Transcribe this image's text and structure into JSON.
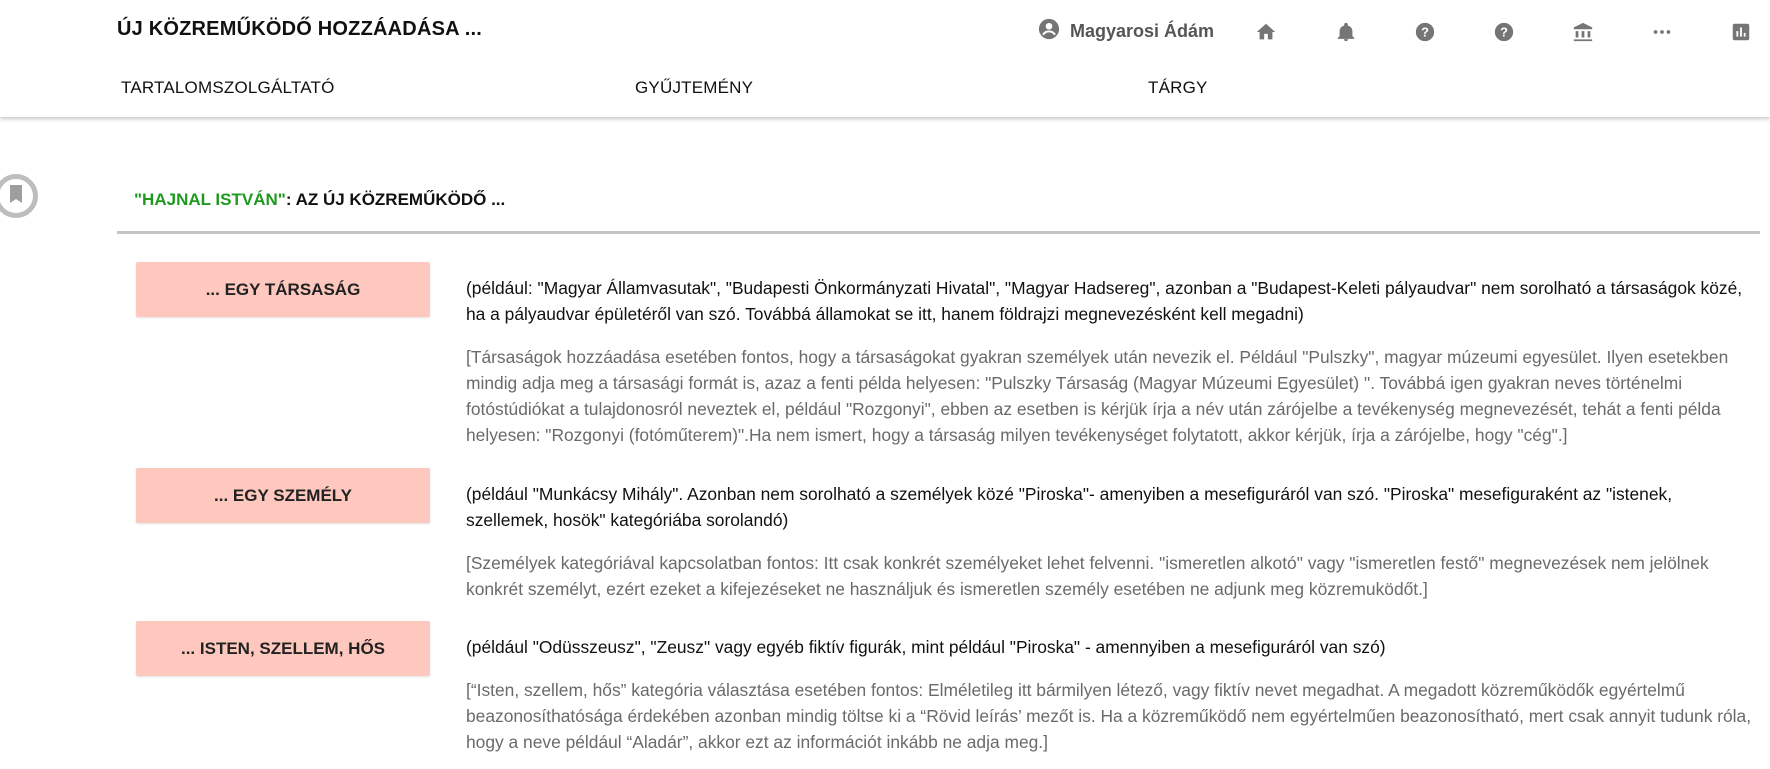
{
  "header": {
    "title": "ÚJ KÖZREMŰKÖDŐ HOZZÁADÁSA ...",
    "user_name": "Magyarosi Ádám",
    "icons": [
      "account-circle-icon",
      "home-icon",
      "bell-icon",
      "help-icon",
      "help-icon-2",
      "institution-icon",
      "more-icon",
      "chart-icon"
    ]
  },
  "tabs": [
    {
      "label": "TARTALOMSZOLGÁLTATÓ"
    },
    {
      "label": "GYŰJTEMÉNY"
    },
    {
      "label": "TÁRGY"
    }
  ],
  "heading": {
    "name": "\"HAJNAL ISTVÁN\"",
    "rest": ": AZ ÚJ KÖZREMŰKÖDŐ ..."
  },
  "categories": [
    {
      "button": "... EGY TÁRSASÁG",
      "description": "(például: \"Magyar Államvasutak\", \"Budapesti Önkormányzati Hivatal\", \"Magyar Hadsereg\", azonban a \"Budapest-Keleti pályaudvar\" nem sorolható a társaságok közé, ha a pályaudvar épületéről van szó. Továbbá államokat se itt, hanem földrajzi megnevezésként kell megadni)",
      "note": "[Társaságok hozzáadása esetében fontos, hogy a társaságokat gyakran személyek után nevezik el. Például \"Pulszky\", magyar múzeumi egyesület. Ilyen esetekben mindig adja meg a társasági formát is, azaz a fenti példa helyesen: \"Pulszky Társaság (Magyar Múzeumi Egyesület) \". Továbbá igen gyakran neves történelmi fotóstúdiókat a tulajdonosról neveztek el, például \"Rozgonyi\", ebben az esetben is kérjük írja a név után zárójelbe a tevékenység megnevezését, tehát a fenti példa helyesen: \"Rozgonyi (fotóműterem)\".Ha nem ismert, hogy a társaság milyen tevékenységet folytatott, akkor kérjük, írja a zárójelbe, hogy \"cég\".]"
    },
    {
      "button": "... EGY SZEMÉLY",
      "description": "(például \"Munkácsy Mihály\". Azonban nem sorolható a személyek közé \"Piroska\"- amenyiben a mesefiguráról van szó. \"Piroska\" mesefiguraként az \"istenek, szellemek, hosök\" kategóriába sorolandó)",
      "note": "[Személyek kategóriával kapcsolatban fontos: Itt csak konkrét személyeket lehet felvenni. \"ismeretlen alkotó\" vagy \"ismeretlen festő\" megnevezések nem jelölnek konkrét személyt, ezért ezeket a kifejezéseket ne használjuk és ismeretlen személy esetében ne adjunk meg közremuködőt.]"
    },
    {
      "button": "... ISTEN, SZELLEM, HŐS",
      "description": "(például \"Odüsszeusz\", \"Zeusz\" vagy egyéb fiktív figurák, mint például \"Piroska\" - amennyiben a mesefiguráról van szó)",
      "note": "[“Isten, szellem, hős” kategória választása esetében fontos: Elméletileg itt bármilyen létező, vagy fiktív nevet megadhat. A megadott közreműködők egyértelmű beazonosíthatósága érdekében azonban mindig töltse ki a “Rövid leírás’ mezőt is. Ha a közreműködő nem egyértelműen beazonosítható, mert csak annyit tudunk róla, hogy a neve például “Aladár”, akkor ezt az információt inkább ne adja meg.]"
    }
  ],
  "colors": {
    "accent_green": "#1f9a1f",
    "button_bg": "#fec8be",
    "note_text": "#6a6a6a"
  }
}
